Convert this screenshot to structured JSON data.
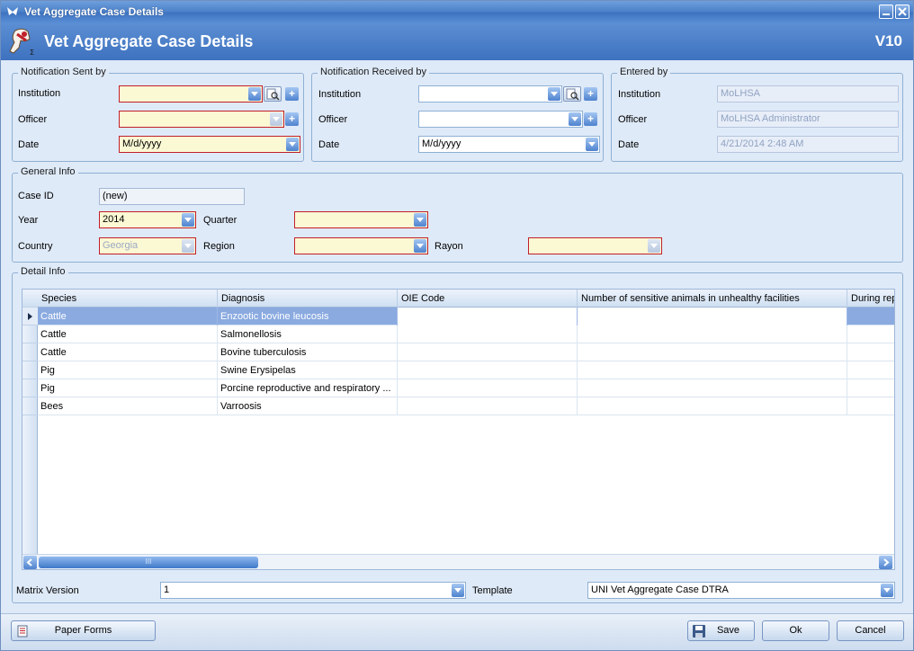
{
  "window": {
    "title": "Vet Aggregate Case Details"
  },
  "header": {
    "title": "Vet Aggregate Case Details",
    "version": "V10"
  },
  "notification_sent": {
    "title": "Notification Sent by",
    "institution_label": "Institution",
    "institution_value": "",
    "officer_label": "Officer",
    "officer_value": "",
    "date_label": "Date",
    "date_value": "M/d/yyyy"
  },
  "notification_received": {
    "title": "Notification Received by",
    "institution_label": "Institution",
    "institution_value": "",
    "officer_label": "Officer",
    "officer_value": "",
    "date_label": "Date",
    "date_value": "M/d/yyyy"
  },
  "entered_by": {
    "title": "Entered by",
    "institution_label": "Institution",
    "institution_value": "MoLHSA",
    "officer_label": "Officer",
    "officer_value": "MoLHSA Administrator",
    "date_label": "Date",
    "date_value": "4/21/2014 2:48 AM"
  },
  "general_info": {
    "title": "General Info",
    "case_id_label": "Case ID",
    "case_id_value": "(new)",
    "year_label": "Year",
    "year_value": "2014",
    "quarter_label": "Quarter",
    "quarter_value": "",
    "country_label": "Country",
    "country_value": "Georgia",
    "region_label": "Region",
    "region_value": "",
    "rayon_label": "Rayon",
    "rayon_value": ""
  },
  "detail_info": {
    "title": "Detail Info",
    "columns": [
      "Species",
      "Diagnosis",
      "OIE Code",
      "Number of sensitive animals in unhealthy facilities",
      "During rep"
    ],
    "rows": [
      [
        "Cattle",
        "Enzootic bovine leucosis",
        "",
        "",
        ""
      ],
      [
        "Cattle",
        "Salmonellosis",
        "",
        "",
        ""
      ],
      [
        "Cattle",
        "Bovine tuberculosis",
        "",
        "",
        ""
      ],
      [
        "Pig",
        "Swine Erysipelas",
        "",
        "",
        ""
      ],
      [
        "Pig",
        "Porcine reproductive and respiratory ...",
        "",
        "",
        ""
      ],
      [
        "Bees",
        "Varroosis",
        "",
        "",
        ""
      ]
    ],
    "selected_row": 0,
    "scroll_thumb_text": "III"
  },
  "matrix": {
    "label": "Matrix Version",
    "value": "1"
  },
  "template": {
    "label": "Template",
    "value": "UNI Vet Aggregate Case DTRA"
  },
  "footer": {
    "paper_forms": "Paper Forms",
    "save": "Save",
    "ok": "Ok",
    "cancel": "Cancel"
  },
  "colors": {
    "required_border": "#c0202a",
    "required_fill": "#fbf8d4",
    "selection": "#8aaae0",
    "header": "#4a7fc8"
  }
}
